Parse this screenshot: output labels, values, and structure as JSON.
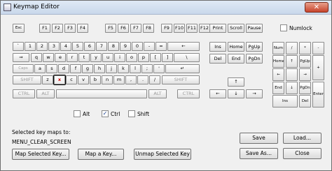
{
  "window": {
    "title": "Keymap Editor",
    "close_glyph": "✕"
  },
  "keys": {
    "row_fn": [
      "Esc",
      "F1",
      "F2",
      "F3",
      "F4",
      "F5",
      "F6",
      "F7",
      "F8",
      "F9",
      "F10",
      "F11",
      "F12"
    ],
    "print": "Print",
    "scroll": "Scroll",
    "pause": "Pause",
    "row_num": [
      "`",
      "1",
      "2",
      "3",
      "4",
      "5",
      "6",
      "7",
      "8",
      "9",
      "0",
      "-",
      "=",
      "←"
    ],
    "row_q": [
      "⇒",
      "q",
      "w",
      "e",
      "r",
      "t",
      "y",
      "u",
      "i",
      "o",
      "p",
      "[",
      "]",
      "\\"
    ],
    "row_a": [
      "Caps",
      "a",
      "s",
      "d",
      "f",
      "g",
      "h",
      "j",
      "k",
      "l",
      ";",
      "'",
      "↵"
    ],
    "row_z": [
      "SHIFT",
      "z",
      "x",
      "c",
      "v",
      "b",
      "n",
      "m",
      ",",
      ".",
      "/",
      "SHIFT"
    ],
    "row_ctrl": [
      "CTRL",
      "ALT",
      "",
      "ALT",
      "CTRL"
    ],
    "nav": [
      "Ins",
      "Home",
      "PgUp",
      "Del",
      "End",
      "PgDn"
    ],
    "arrows": [
      "↑",
      "←",
      "↓",
      "→"
    ],
    "numpad": [
      "Num",
      "/",
      "*",
      "-",
      "Home",
      "↑",
      "PgUp",
      "+",
      "←",
      "",
      "→",
      "End",
      "↓",
      "PgDn",
      "Enter",
      "Ins",
      "Del"
    ]
  },
  "numlock": {
    "label": "Numlock",
    "checked": false
  },
  "modifiers": [
    {
      "label": "Alt",
      "checked": false
    },
    {
      "label": "Ctrl",
      "checked": true
    },
    {
      "label": "Shift",
      "checked": false
    }
  ],
  "check_glyph": "✓",
  "selected": {
    "heading": "Selected key maps to:",
    "value": "MENU_CLEAR_SCREEN"
  },
  "buttons": {
    "map_selected": "Map Selected Key...",
    "map_a_key": "Map a Key...",
    "unmap": "Unmap Selected Key",
    "save": "Save",
    "load": "Load...",
    "save_as": "Save As...",
    "close": "Close"
  }
}
